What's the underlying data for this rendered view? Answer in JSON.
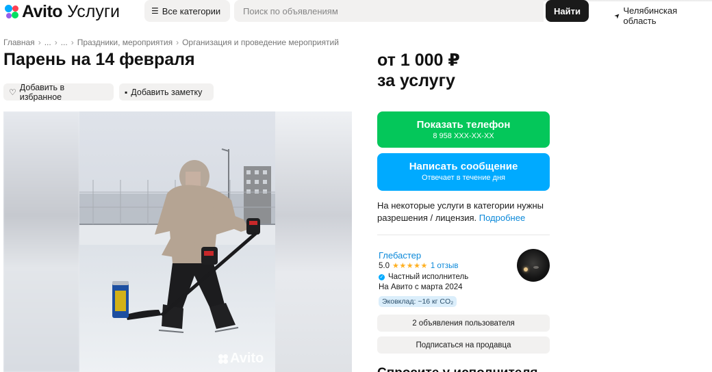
{
  "header": {
    "logo_text": "Avito",
    "logo_sub": "Услуги",
    "categories_label": "Все категории",
    "search_placeholder": "Поиск по объявлениям",
    "search_button": "Найти",
    "region": "Челябинская область"
  },
  "breadcrumb": [
    "Главная",
    "...",
    "...",
    "Праздники, мероприятия",
    "Организация и проведение мероприятий"
  ],
  "listing": {
    "title": "Парень на 14 февраля",
    "favorite_label": "Добавить в избранное",
    "note_label": "Добавить заметку",
    "photo_watermark": "Avito",
    "price_line1": "от 1 000 ₽",
    "price_line2": "за услугу"
  },
  "actions": {
    "phone_label": "Показать телефон",
    "phone_number": "8 958 XXX-XX-XX",
    "message_label": "Написать сообщение",
    "message_sub": "Отвечает в течение дня"
  },
  "license": {
    "text": "На некоторые услуги в категории нужны разрешения / лицензия.",
    "link": "Подробнее"
  },
  "seller": {
    "name": "Глебастер",
    "rating": "5.0",
    "stars": "★★★★★",
    "rating_value": 5,
    "reviews": "1 отзыв",
    "type": "Частный исполнитель",
    "since": "На Авито с марта 2024",
    "eco": "Эковклад: ~16 кг CO₂",
    "ads_button": "2 объявления пользователя",
    "subscribe_button": "Подписаться на продавца"
  },
  "section": {
    "heading_partial": "Спросите у исполнителя"
  },
  "colors": {
    "green": "#04c75a",
    "blue": "#00aaff",
    "link": "#0a88d9",
    "star": "#ffb021"
  }
}
